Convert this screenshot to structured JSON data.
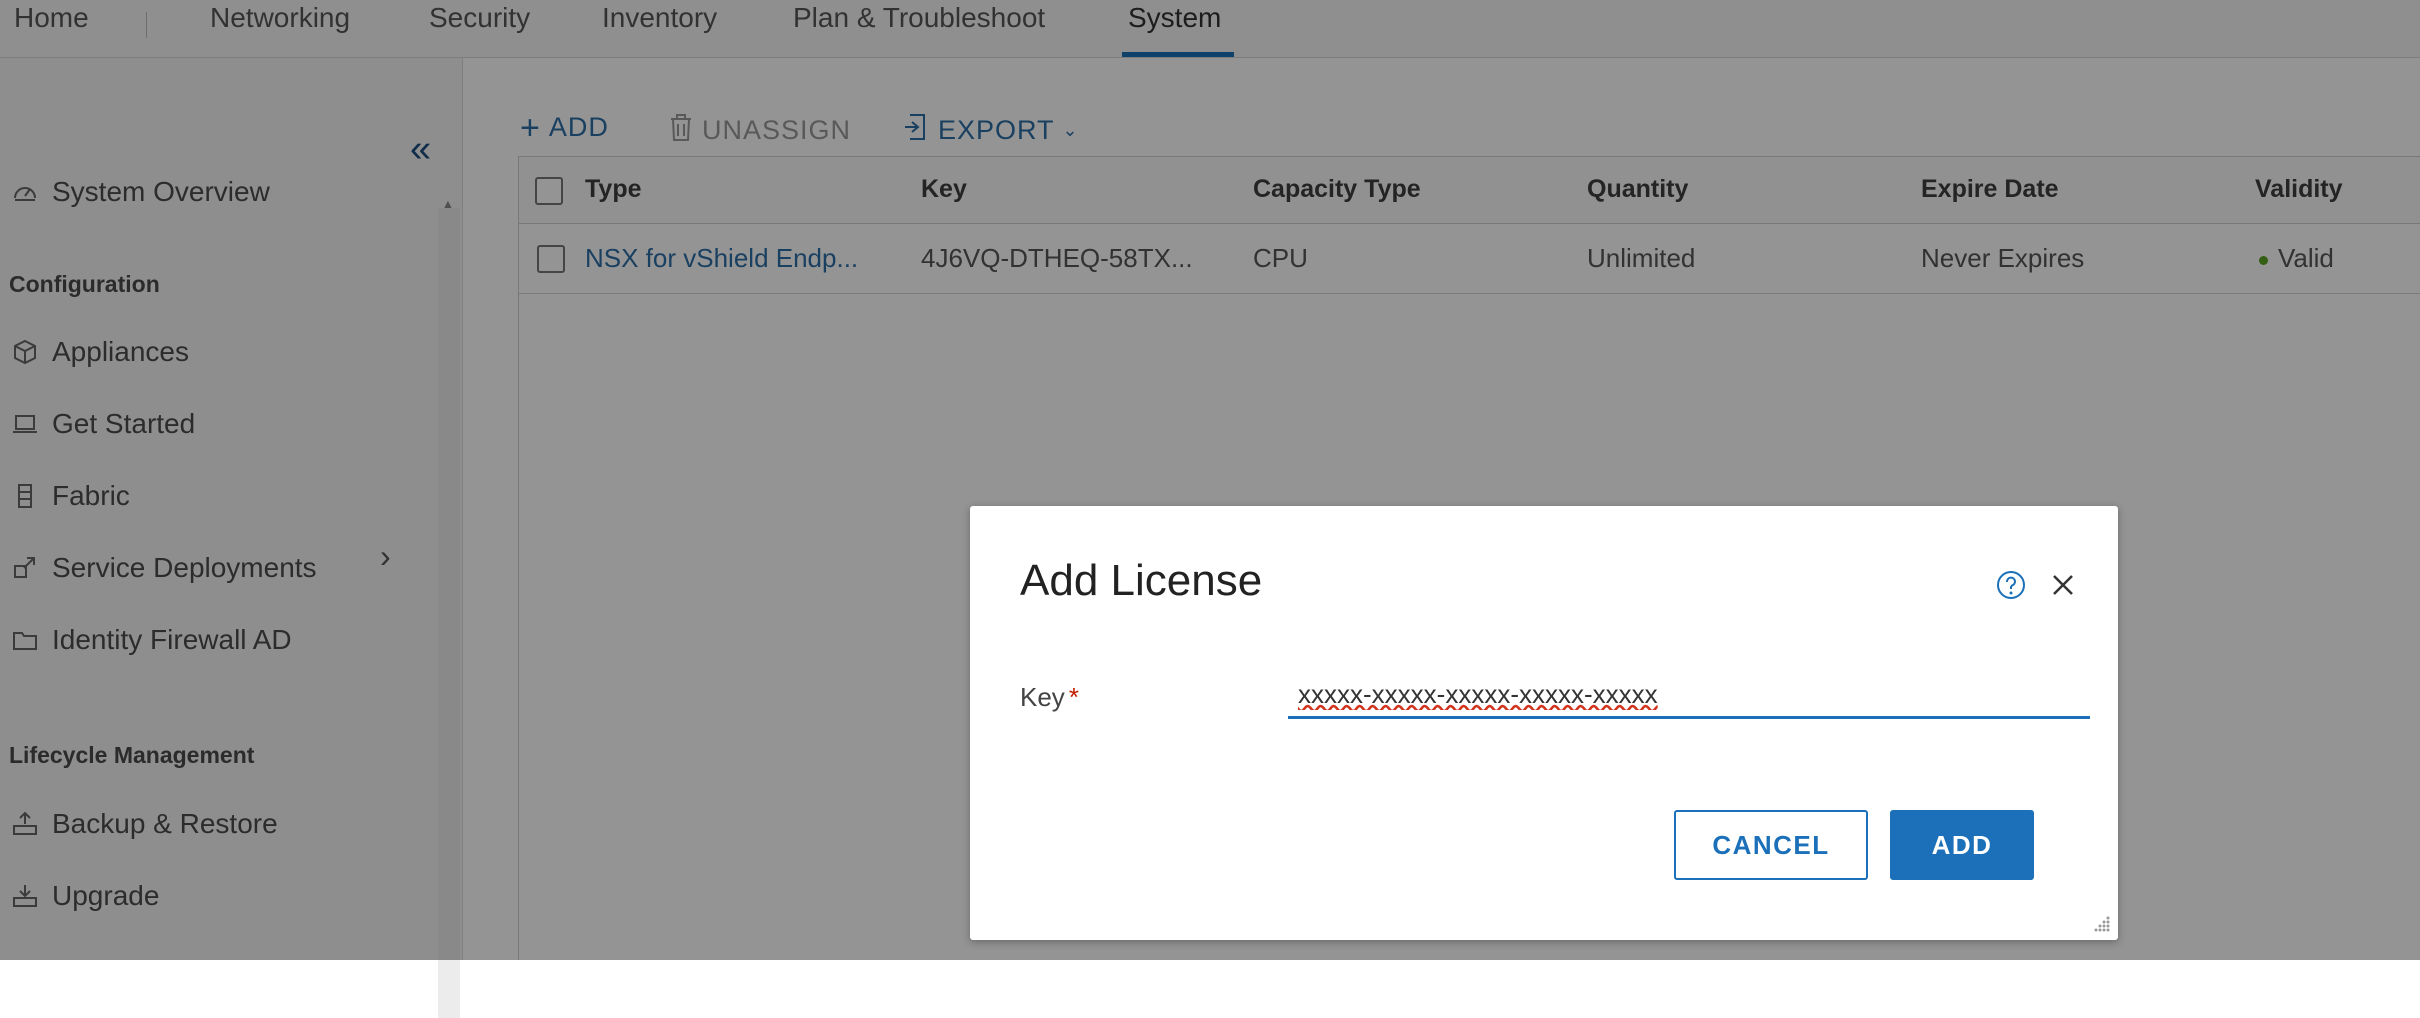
{
  "nav": {
    "tabs": [
      "Home",
      "Networking",
      "Security",
      "Inventory",
      "Plan & Troubleshoot",
      "System"
    ],
    "active": "System"
  },
  "sidebar": {
    "overview": "System Overview",
    "configuration_header": "Configuration",
    "items": [
      "Appliances",
      "Get Started",
      "Fabric",
      "Service Deployments",
      "Identity Firewall AD"
    ],
    "lifecycle_header": "Lifecycle Management",
    "lifecycle_items": [
      "Backup & Restore",
      "Upgrade"
    ]
  },
  "toolbar": {
    "add": "ADD",
    "unassign": "UNASSIGN",
    "export": "EXPORT"
  },
  "grid": {
    "columns": [
      "Type",
      "Key",
      "Capacity Type",
      "Quantity",
      "Expire Date",
      "Validity"
    ],
    "rows": [
      {
        "type": "NSX for vShield Endp...",
        "key": "4J6VQ-DTHEQ-58TX...",
        "capacity": "CPU",
        "quantity": "Unlimited",
        "expire": "Never Expires",
        "validity": "Valid"
      }
    ]
  },
  "colors": {
    "accent": "#1b70b9",
    "valid": "#5aa220",
    "required": "#c21d00"
  },
  "dialog": {
    "title": "Add License",
    "key_label": "Key",
    "required_mark": "*",
    "key_value": "xxxxx-xxxxx-xxxxx-xxxxx-xxxxx",
    "cancel": "CANCEL",
    "add": "ADD"
  }
}
